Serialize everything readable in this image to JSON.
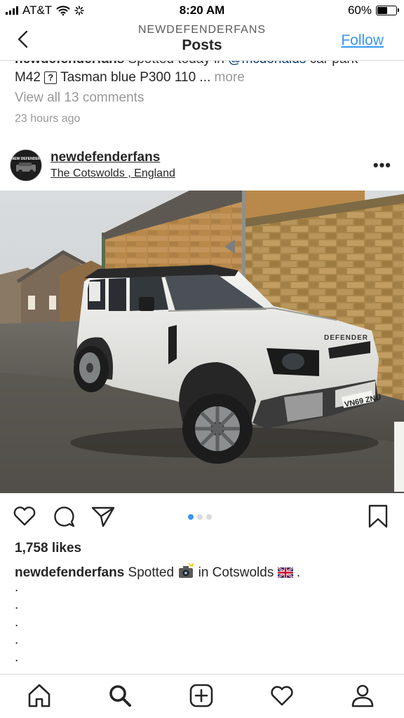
{
  "status_bar": {
    "carrier": "AT&T",
    "time": "8:20 AM",
    "battery_percent": "60%",
    "battery_level": 0.6
  },
  "header": {
    "account": "NEWDEFENDERFANS",
    "title": "Posts",
    "follow_label": "Follow"
  },
  "previous_post": {
    "caption_user": "newdefenderfans",
    "caption_text_1": " Spotted today in ",
    "caption_mention": "@mcdonalds",
    "caption_text_2": " car park",
    "caption_line2_a": "M42",
    "caption_symbol": "?",
    "caption_line2_b": "Tasman blue P300 110 ...",
    "more_label": "more",
    "view_comments": "View all 13 comments",
    "time_ago": "23 hours ago"
  },
  "post": {
    "avatar_text": "NEW DEFENDER",
    "username": "newdefenderfans",
    "location": "The Cotswolds , England",
    "options_icon": "more-options-icon",
    "photo": {
      "plate": "VN69 ZNU",
      "badge": "DEFENDER"
    },
    "pager": {
      "count": 3,
      "active": 0
    },
    "likes": "1,758 likes",
    "caption_user": "newdefenderfans",
    "caption_text_1": " Spotted ",
    "caption_emoji_icon": "camera-flash-icon",
    "caption_text_2": " in Cotswolds ",
    "caption_flag_icon": "uk-flag-icon",
    "caption_text_3": " .",
    "caption_dots": [
      ".",
      ".",
      ".",
      ".",
      "."
    ]
  },
  "actions": {
    "like_icon": "heart-icon",
    "comment_icon": "comment-icon",
    "share_icon": "send-icon",
    "save_icon": "bookmark-icon"
  },
  "tab_bar": [
    "home-icon",
    "search-icon",
    "new-post-icon",
    "activity-icon",
    "profile-icon"
  ],
  "colors": {
    "link": "#3897f0",
    "text": "#262626",
    "muted": "#999999",
    "divider": "#dbdbdb"
  }
}
